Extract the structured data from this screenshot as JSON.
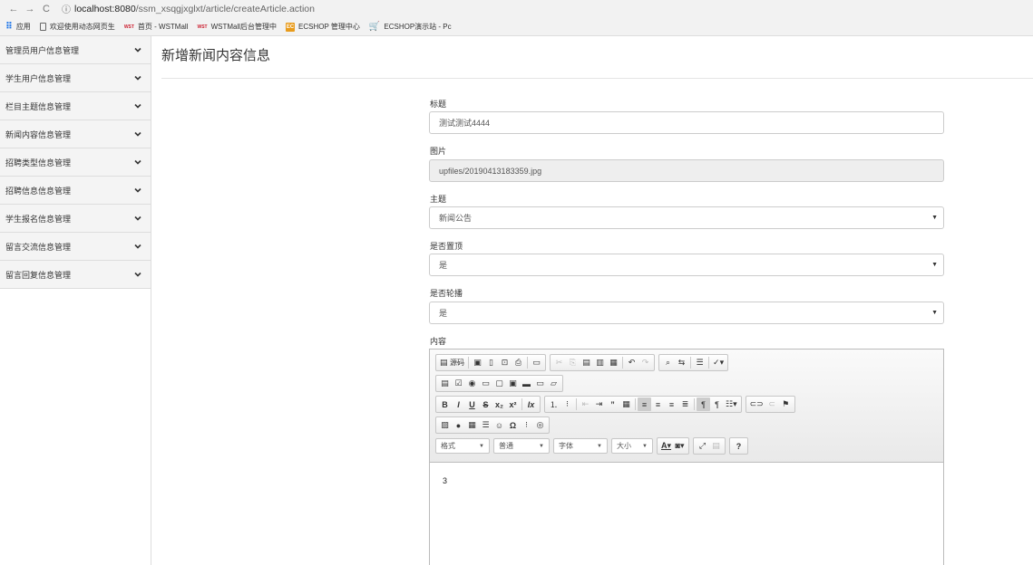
{
  "browser": {
    "url_host": "localhost:8080",
    "url_path": "/ssm_xsqgjxglxt/article/createArticle.action",
    "bookmarks": [
      {
        "icon": "apps-icon",
        "label": "应用"
      },
      {
        "icon": "page-icon",
        "label": "欢迎使用动态网页生"
      },
      {
        "icon": "wst-icon",
        "label": "首页 - WSTMall"
      },
      {
        "icon": "wst-icon",
        "label": "WSTMall后台管理中"
      },
      {
        "icon": "ecshop-icon",
        "label": "ECSHOP 管理中心"
      },
      {
        "icon": "cart-icon",
        "label": "ECSHOP演示站 - Pc"
      }
    ]
  },
  "sidebar": {
    "items": [
      {
        "label": "管理员用户信息管理"
      },
      {
        "label": "学生用户信息管理"
      },
      {
        "label": "栏目主题信息管理"
      },
      {
        "label": "新闻内容信息管理"
      },
      {
        "label": "招聘类型信息管理"
      },
      {
        "label": "招聘信息信息管理"
      },
      {
        "label": "学生报名信息管理"
      },
      {
        "label": "留言交流信息管理"
      },
      {
        "label": "留言回复信息管理"
      }
    ]
  },
  "page": {
    "title": "新增新闻内容信息"
  },
  "form": {
    "title_label": "标题",
    "title_value": "测试测试4444",
    "image_label": "图片",
    "image_value": "upfiles/20190413183359.jpg",
    "topic_label": "主题",
    "topic_value": "新闻公告",
    "pinned_label": "是否置顶",
    "pinned_value": "是",
    "carousel_label": "是否轮播",
    "carousel_value": "是",
    "content_label": "内容",
    "content_value": "3"
  },
  "editor": {
    "source_label": "源码",
    "format_label": "格式",
    "paragraph_label": "普通",
    "font_label": "字体",
    "size_label": "大小",
    "help_label": "?"
  }
}
